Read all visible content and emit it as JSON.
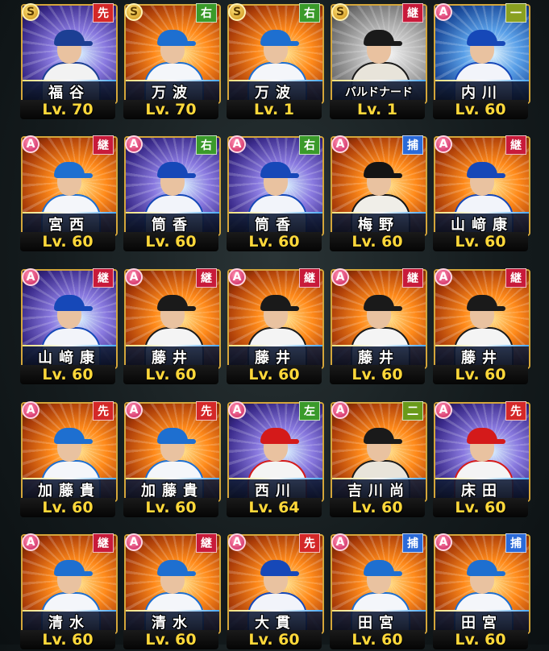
{
  "colors": {
    "starter": "#d42828",
    "relief": "#c81a3a",
    "right_field": "#3a9a2a",
    "left_field": "#3a9a2a",
    "catcher": "#2a6ad8",
    "first_base": "#8aa020",
    "second_base": "#6a9a1a",
    "level_text": "#ffd83a"
  },
  "cards": [
    {
      "rank": "S",
      "position": "先",
      "name": "福谷",
      "level": "Lv. 70",
      "theme": "purple",
      "team": "dragons"
    },
    {
      "rank": "S",
      "position": "右",
      "name": "万波",
      "level": "Lv. 70",
      "theme": "orange",
      "team": "fighters"
    },
    {
      "rank": "S",
      "position": "右",
      "name": "万波",
      "level": "Lv. 1",
      "theme": "orange",
      "team": "fighters"
    },
    {
      "rank": "S",
      "position": "継",
      "name": "バルドナード",
      "level": "Lv. 1",
      "theme": "gray",
      "team": "giants"
    },
    {
      "rank": "A",
      "position": "一",
      "name": "内川",
      "level": "Lv. 60",
      "theme": "blue",
      "team": "baystars"
    },
    {
      "rank": "A",
      "position": "継",
      "name": "宮西",
      "level": "Lv. 60",
      "theme": "orange",
      "team": "fighters"
    },
    {
      "rank": "A",
      "position": "右",
      "name": "筒香",
      "level": "Lv. 60",
      "theme": "purple",
      "team": "baystars"
    },
    {
      "rank": "A",
      "position": "右",
      "name": "筒香",
      "level": "Lv. 60",
      "theme": "purple",
      "team": "baystars"
    },
    {
      "rank": "A",
      "position": "捕",
      "name": "梅野",
      "level": "Lv. 60",
      "theme": "orange",
      "team": "tigers"
    },
    {
      "rank": "A",
      "position": "継",
      "name": "山﨑康",
      "level": "Lv. 60",
      "theme": "orange",
      "team": "baystars"
    },
    {
      "rank": "A",
      "position": "継",
      "name": "山﨑康",
      "level": "Lv. 60",
      "theme": "purple",
      "team": "baystars"
    },
    {
      "rank": "A",
      "position": "継",
      "name": "藤井",
      "level": "Lv. 60",
      "theme": "orange",
      "team": "hawks"
    },
    {
      "rank": "A",
      "position": "継",
      "name": "藤井",
      "level": "Lv. 60",
      "theme": "orange",
      "team": "hawks"
    },
    {
      "rank": "A",
      "position": "継",
      "name": "藤井",
      "level": "Lv. 60",
      "theme": "orange",
      "team": "hawks"
    },
    {
      "rank": "A",
      "position": "継",
      "name": "藤井",
      "level": "Lv. 60",
      "theme": "orange",
      "team": "hawks"
    },
    {
      "rank": "A",
      "position": "先",
      "name": "加藤貴",
      "level": "Lv. 60",
      "theme": "orange",
      "team": "fighters"
    },
    {
      "rank": "A",
      "position": "先",
      "name": "加藤貴",
      "level": "Lv. 60",
      "theme": "orange",
      "team": "fighters"
    },
    {
      "rank": "A",
      "position": "左",
      "name": "西川",
      "level": "Lv. 64",
      "theme": "purple",
      "team": "carp"
    },
    {
      "rank": "A",
      "position": "二",
      "name": "吉川尚",
      "level": "Lv. 60",
      "theme": "orange",
      "team": "giants"
    },
    {
      "rank": "A",
      "position": "先",
      "name": "床田",
      "level": "Lv. 60",
      "theme": "purple",
      "team": "carp"
    },
    {
      "rank": "A",
      "position": "継",
      "name": "清水",
      "level": "Lv. 60",
      "theme": "orange",
      "team": "fighters"
    },
    {
      "rank": "A",
      "position": "継",
      "name": "清水",
      "level": "Lv. 60",
      "theme": "orange",
      "team": "fighters"
    },
    {
      "rank": "A",
      "position": "先",
      "name": "大貫",
      "level": "Lv. 60",
      "theme": "orange",
      "team": "baystars"
    },
    {
      "rank": "A",
      "position": "捕",
      "name": "田宮",
      "level": "Lv. 60",
      "theme": "orange",
      "team": "fighters"
    },
    {
      "rank": "A",
      "position": "捕",
      "name": "田宮",
      "level": "Lv. 60",
      "theme": "orange",
      "team": "fighters"
    }
  ]
}
